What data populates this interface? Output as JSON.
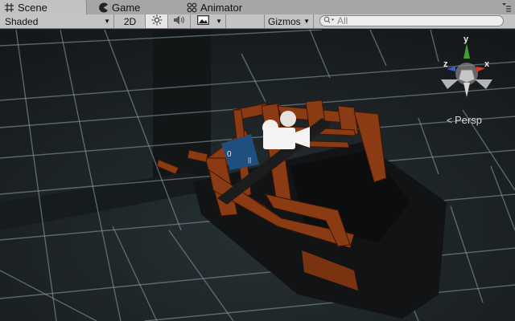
{
  "tabs": {
    "scene": "Scene",
    "game": "Game",
    "animator": "Animator"
  },
  "toolbar": {
    "shading": "Shaded",
    "mode_2d": "2D",
    "gizmos": "Gizmos",
    "search_placeholder": "All"
  },
  "gizmo": {
    "x_label": "x",
    "y_label": "y",
    "z_label": "z",
    "projection": "Persp"
  },
  "icons": [
    "hash-icon",
    "pacman-icon",
    "animator-icon",
    "menu-icon",
    "sun-icon",
    "speaker-icon",
    "image-icon",
    "search-icon",
    "camera-icon"
  ],
  "colors": {
    "tab_bar": "#a6a6a6",
    "toolbar": "#c4c4c4",
    "viewport_bg": "#1a1d1f",
    "grid": "#8fa3a8",
    "wood": "#8b3b13",
    "axis_x": "#d23a2a",
    "axis_y": "#3fa02e",
    "axis_z": "#3a5fd2"
  }
}
